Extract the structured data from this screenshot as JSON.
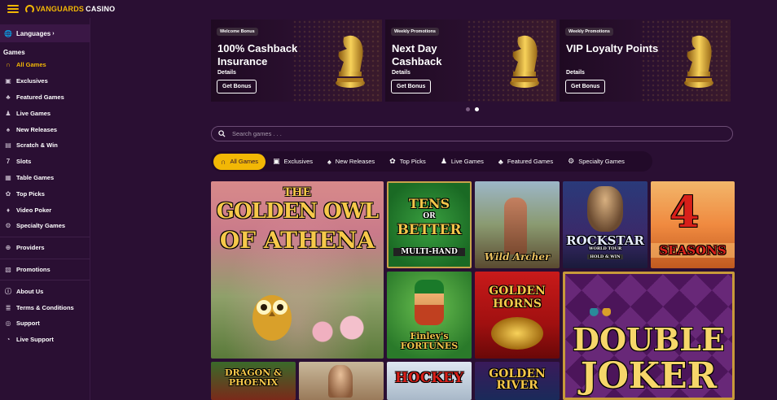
{
  "header": {
    "brand": "VANGUARDS",
    "brand_suffix": "CASINO"
  },
  "sidebar": {
    "languages": "Languages",
    "games_label": "Games",
    "game_items": [
      {
        "label": "All Games",
        "icon": "horseshoe-icon",
        "active": true
      },
      {
        "label": "Exclusives",
        "icon": "exclusive-icon"
      },
      {
        "label": "Featured Games",
        "icon": "clover-icon"
      },
      {
        "label": "Live Games",
        "icon": "dealer-icon"
      },
      {
        "label": "New Releases",
        "icon": "cards-icon"
      },
      {
        "label": "Scratch & Win",
        "icon": "scratch-icon"
      },
      {
        "label": "Slots",
        "icon": "seven-icon"
      },
      {
        "label": "Table Games",
        "icon": "table-icon"
      },
      {
        "label": "Top Picks",
        "icon": "ribbon-icon"
      },
      {
        "label": "Video Poker",
        "icon": "poker-icon"
      },
      {
        "label": "Specialty Games",
        "icon": "gear-icon"
      }
    ],
    "providers": "Providers",
    "promotions": "Promotions",
    "footer_items": [
      {
        "label": "About Us",
        "icon": "info-icon"
      },
      {
        "label": "Terms & Conditions",
        "icon": "document-icon"
      },
      {
        "label": "Support",
        "icon": "globe-icon"
      },
      {
        "label": "Live Support",
        "icon": "chat-icon"
      }
    ]
  },
  "promos": [
    {
      "tag": "Welcome Bonus",
      "title": "100% Cashback Insurance",
      "details": "Details",
      "button": "Get Bonus"
    },
    {
      "tag": "Weekly Promotions",
      "title": "Next Day Cashback",
      "details": "Details",
      "button": "Get Bonus"
    },
    {
      "tag": "Weekly Promotions",
      "title": "VIP Loyalty Points",
      "details": "Details",
      "button": "Get Bonus"
    }
  ],
  "search": {
    "placeholder": "Search games . . ."
  },
  "tabs": [
    {
      "label": "All Games",
      "icon": "horseshoe-icon",
      "active": true
    },
    {
      "label": "Exclusives",
      "icon": "exclusive-icon"
    },
    {
      "label": "New Releases",
      "icon": "cards-icon"
    },
    {
      "label": "Top Picks",
      "icon": "ribbon-icon"
    },
    {
      "label": "Live Games",
      "icon": "dealer-icon"
    },
    {
      "label": "Featured Games",
      "icon": "clover-icon"
    },
    {
      "label": "Specialty Games",
      "icon": "gear-icon"
    }
  ],
  "games": {
    "golden_owl": {
      "title_top": "THE",
      "title_mid": "GOLDEN OWL",
      "title_bot": "OF ATHENA"
    },
    "tens_or_better": {
      "line1": "TENS",
      "line2": "OR",
      "line3": "BETTER",
      "line4": "MULTI-HAND"
    },
    "wild_archer": {
      "title": "Wild Archer"
    },
    "rockstar": {
      "title": "ROCKSTAR",
      "sub": "WORLD TOUR",
      "badge": "HOLD & WIN"
    },
    "four_seasons": {
      "num": "4",
      "title": "SEASONS"
    },
    "finleys_fortunes": {
      "title": "Finley's FORTUNES"
    },
    "golden_horns": {
      "title": "GOLDEN HORNS"
    },
    "double_joker": {
      "line1": "DOUBLE",
      "line2": "JOKER"
    },
    "dragon_phoenix": {
      "title": "DRAGON & PHOENIX"
    },
    "hockey": {
      "title": "HOCKEY"
    },
    "golden_river": {
      "title": "GOLDEN RIVER"
    }
  }
}
